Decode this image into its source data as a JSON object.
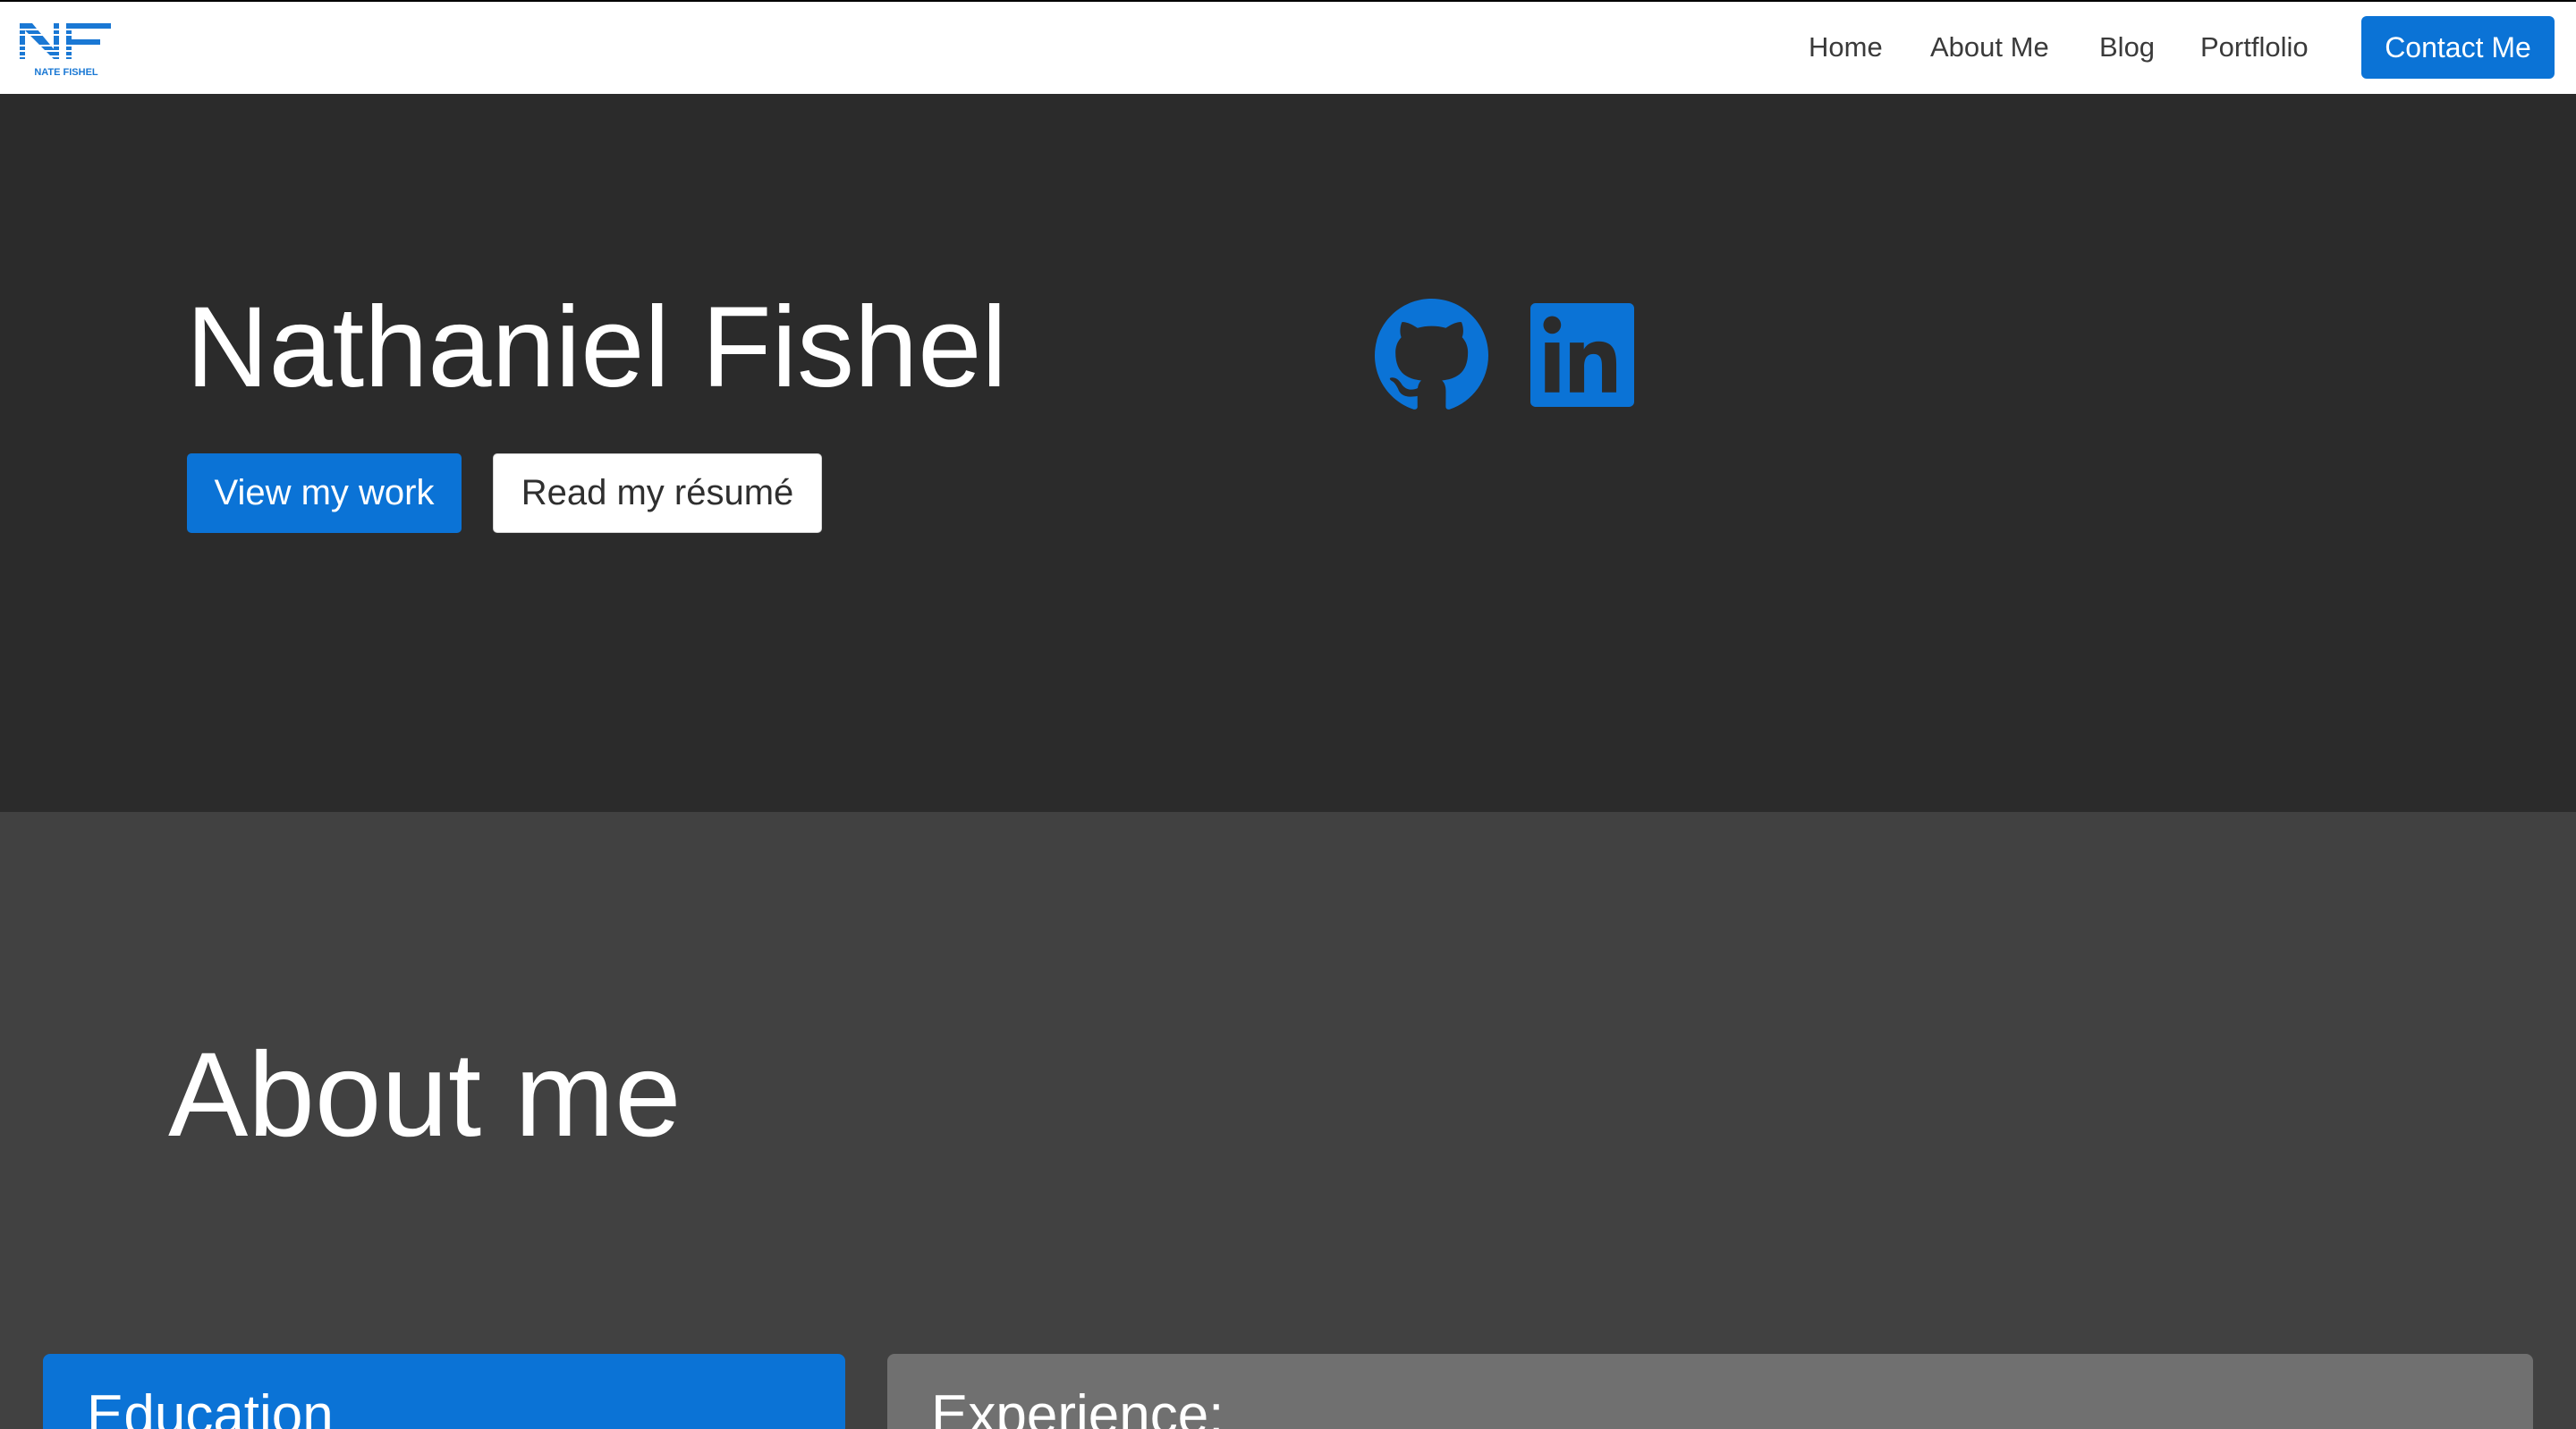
{
  "navbar": {
    "logo": {
      "monogram": "NF",
      "wordmark": "NATE FISHEL",
      "color": "#1a78d4"
    },
    "links": [
      {
        "label": "Home"
      },
      {
        "label": "About Me"
      },
      {
        "label": "Blog"
      },
      {
        "label": "Portflolio"
      }
    ],
    "contact_label": "Contact Me"
  },
  "hero": {
    "name": "Nathaniel Fishel",
    "primary_button": "View my work",
    "secondary_button": "Read my résumé",
    "social": [
      {
        "icon": "github-icon"
      },
      {
        "icon": "linkedin-icon"
      }
    ]
  },
  "about": {
    "title": "About me",
    "cards": [
      {
        "title": "Education"
      },
      {
        "title": "Experience:"
      }
    ]
  },
  "colors": {
    "accent": "#0b73d6",
    "hero_bg": "#2b2b2b",
    "about_bg": "#414141",
    "experience_card_bg": "#707070",
    "navbar_bg": "#ffffff"
  }
}
